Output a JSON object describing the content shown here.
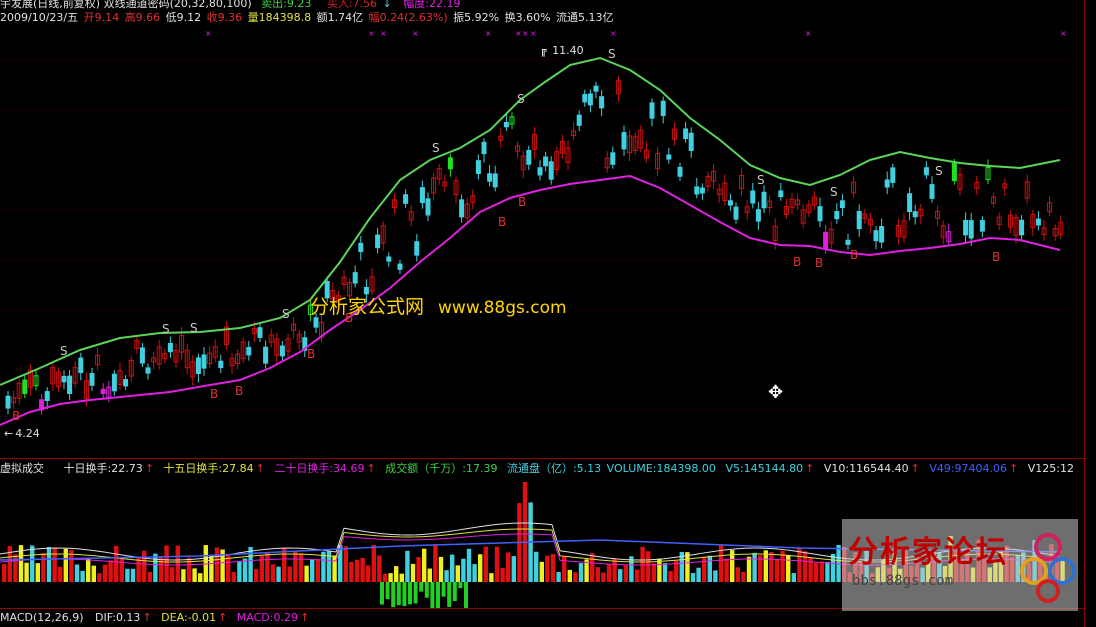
{
  "header": {
    "title": "宇发展(日线,前复权) 双线通道密码(20,32,80,100)",
    "sell_label": "卖出:9.23",
    "buy_label": "买入:7.56",
    "down_arrow": "↓",
    "amplitude_label": "幅度:22.19"
  },
  "quote": {
    "date": "2009/10/23/五",
    "open": "开9.14",
    "high": "高9.66",
    "low": "低9.12",
    "close": "收9.36",
    "volume": "量184398.8",
    "amount": "额1.74亿",
    "change": "幅0.24(2.63%)",
    "swing": "振5.92%",
    "turnover": "换3.60%",
    "float": "流通5.13亿"
  },
  "price_chart": {
    "high_marker": "11.40",
    "low_marker": "4.24",
    "sell_signal": "S",
    "buy_signal": "B",
    "upper_line_color": "#5ad45a",
    "lower_line_color": "#e020e0",
    "up_color": "#d01010",
    "down_color": "#40d0e0"
  },
  "indicator": {
    "name": "虚拟成交",
    "ten_day": "十日换手:22.73",
    "fifteen_day": "十五日换手:27.84",
    "twenty_day": "二十日换手:34.69",
    "amount": "成交额（千万）:17.39",
    "float_cap": "流通盘（亿）:5.13",
    "volume": "VOLUME:184398.00",
    "v5": "V5:145144.80",
    "v10": "V10:116544.40",
    "v49": "V49:97404.06",
    "v125": "V125:12",
    "arrow": "↑"
  },
  "macd": {
    "name": "MACD(12,26,9)",
    "dif": "DIF:0.13",
    "dea": "DEA:-0.01",
    "macd": "MACD:0.29",
    "arrow": "↑"
  },
  "watermark": {
    "cn": "分析家公式网",
    "url": "www.88gs.com"
  },
  "logo": {
    "title": "分析家论坛",
    "url": "bbs.88gs.com"
  }
}
